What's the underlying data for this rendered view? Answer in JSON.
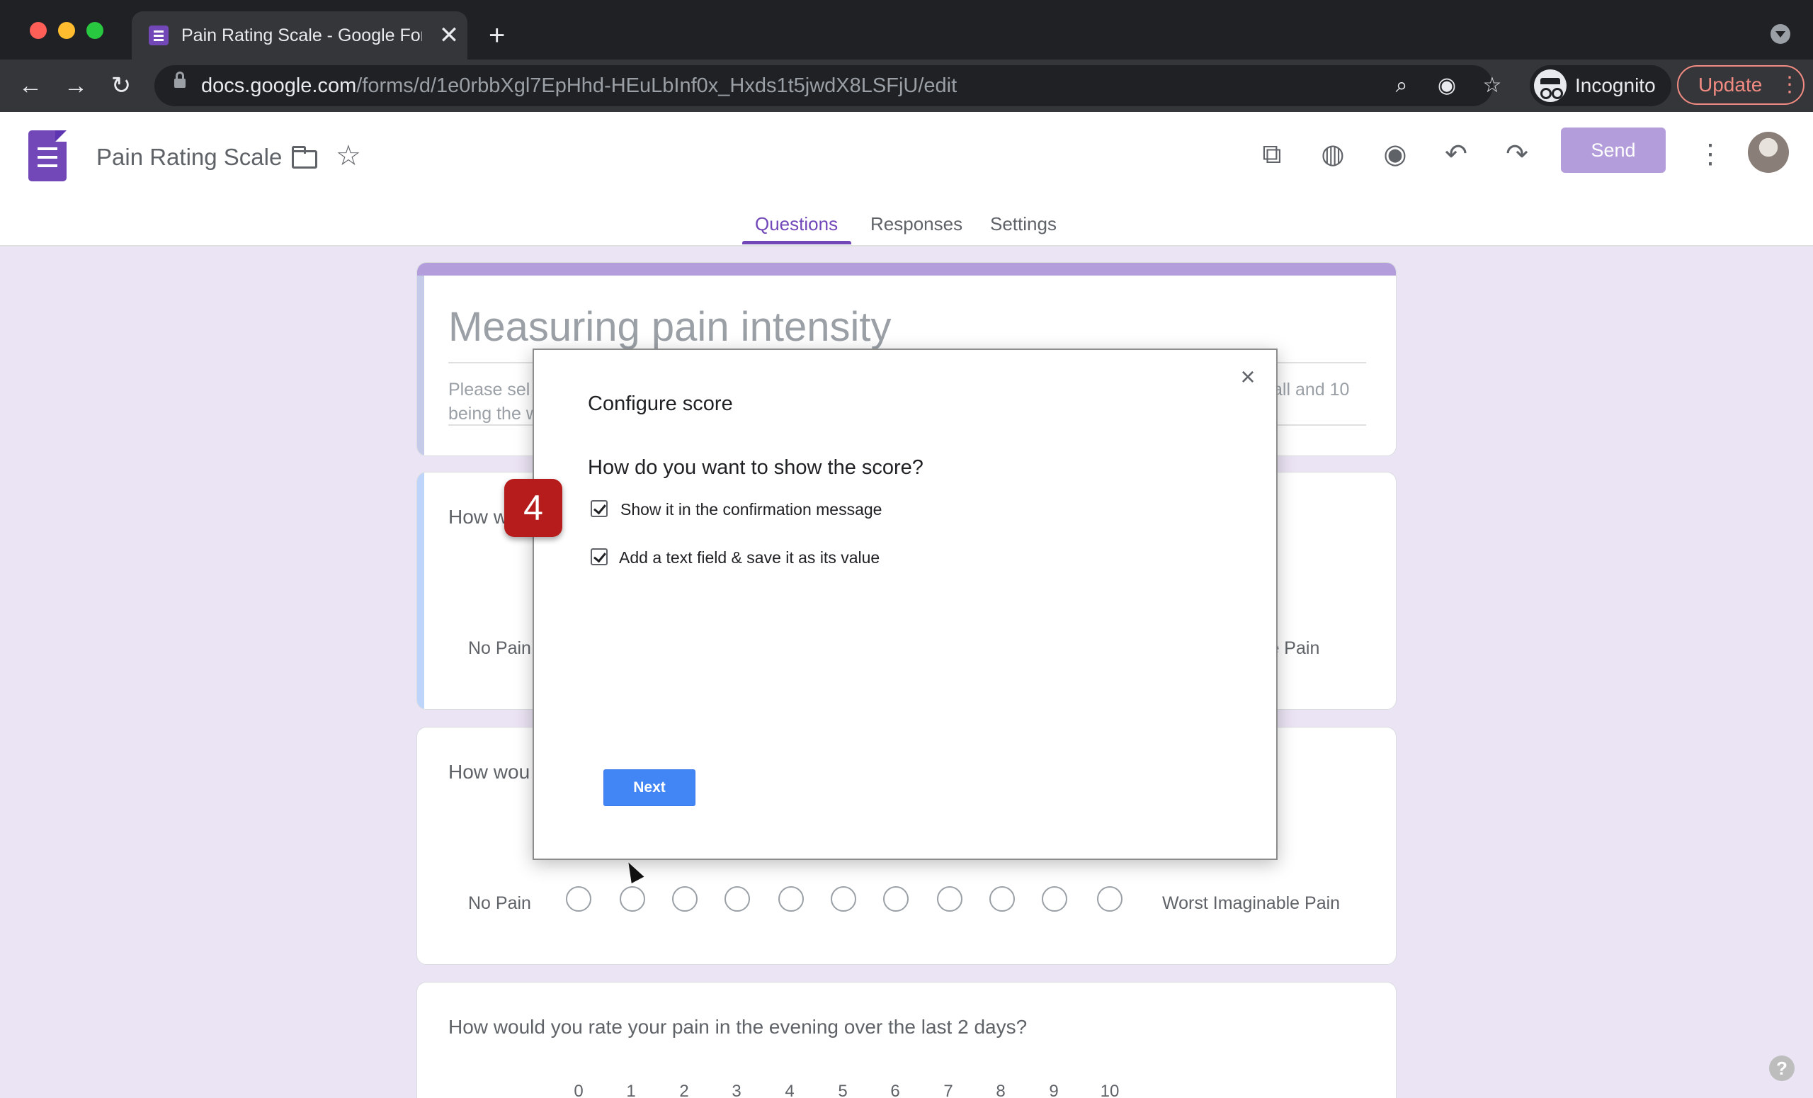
{
  "browser": {
    "tab_title": "Pain Rating Scale - Google Forms",
    "new_tab_label": "+",
    "tab_close": "✕",
    "url_host": "docs.google.com",
    "url_path": "/forms/d/1e0rbbXgl7EpHhd-HEuLbInf0x_Hxds1t5jwdX8LSFjU/edit",
    "incognito_label": "Incognito",
    "update_label": "Update"
  },
  "app": {
    "doc_title": "Pain Rating Scale",
    "send_label": "Send",
    "tabs": [
      {
        "label": "Questions",
        "active": true
      },
      {
        "label": "Responses",
        "active": false
      },
      {
        "label": "Settings",
        "active": false
      }
    ]
  },
  "form": {
    "title": "Measuring pain intensity",
    "description_start": "Please sel",
    "description_end": "all and 10",
    "description_line2": "being the w",
    "q1": {
      "title_visible": "How w",
      "left_label": "No Pain",
      "right_label_visible": "ble Pain"
    },
    "q2": {
      "title_visible": "How wou",
      "left_label": "No Pain",
      "right_label": "Worst Imaginable Pain"
    },
    "q3": {
      "title": "How would you rate your pain in the evening over the last 2 days?",
      "scale": [
        "0",
        "1",
        "2",
        "3",
        "4",
        "5",
        "6",
        "7",
        "8",
        "9",
        "10"
      ]
    }
  },
  "modal": {
    "title": "Configure score",
    "close_label": "×",
    "question": "How do you want to show the score?",
    "options": [
      {
        "label": "Show it in the confirmation message",
        "checked": true
      },
      {
        "label": "Add a text field & save it as its value",
        "checked": true
      }
    ],
    "next_label": "Next"
  },
  "step_badge": "4",
  "help_label": "?",
  "colors": {
    "accent": "#7248b9",
    "send_button": "#b39ddb",
    "next_button": "#4285f4",
    "step_badge": "#b71c1c"
  }
}
